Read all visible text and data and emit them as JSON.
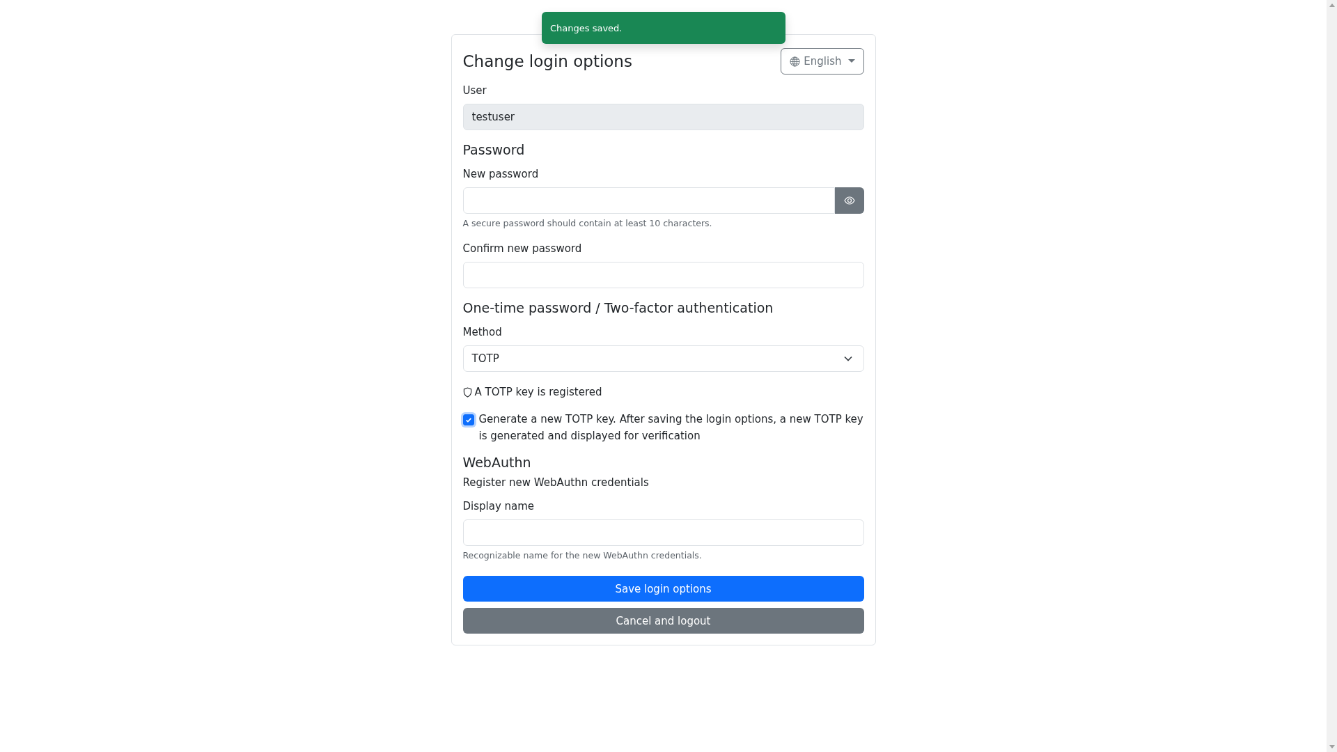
{
  "toast": {
    "text": "Changes saved."
  },
  "title": "Change login options",
  "language_button": {
    "label": "English"
  },
  "user": {
    "label": "User",
    "value": "testuser",
    "disabled": true
  },
  "password": {
    "heading": "Password",
    "new_password": {
      "label": "New password",
      "help": "A secure password should contain at least 10 characters."
    },
    "confirm_password": {
      "label": "Confirm new password"
    }
  },
  "otp": {
    "heading": "One-time password / Two-factor authentication",
    "method": {
      "label": "Method",
      "value": "TOTP"
    },
    "status": "A TOTP key is registered",
    "regenerate": {
      "label": "Generate a new TOTP key. After saving the login options, a new TOTP key is generated and displayed for verification",
      "checked": true
    }
  },
  "webauthn": {
    "heading": "WebAuthn",
    "description": "Register new WebAuthn credentials",
    "display_name": {
      "label": "Display name",
      "help": "Recognizable name for the new WebAuthn credentials."
    }
  },
  "buttons": [
    {
      "label": "Save login options",
      "kind": "primary"
    },
    {
      "label": "Cancel and logout",
      "kind": "secondary"
    }
  ]
}
